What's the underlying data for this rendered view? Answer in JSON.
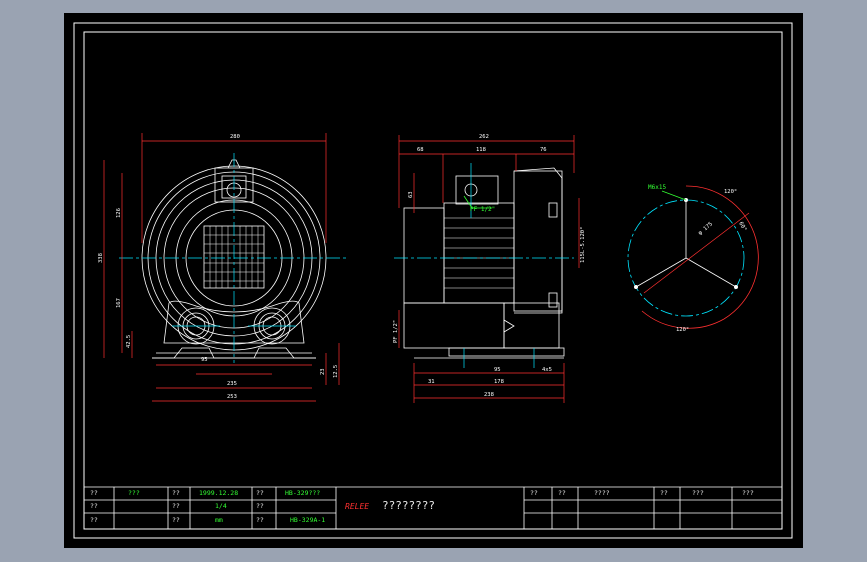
{
  "drawing": {
    "front_dims": {
      "top_width": "280",
      "width_mid": "235",
      "width_bottom": "253",
      "inner_base": "95",
      "height_total": "338",
      "height_upper": "126",
      "height_lower": "167",
      "base_small": "23",
      "base_small2": "12.5",
      "left_small": "42.5"
    },
    "side_dims": {
      "top_total": "262",
      "top_a": "68",
      "top_b": "118",
      "top_c": "76",
      "bottom_a": "31",
      "bottom_b": "95",
      "bottom_c": "178",
      "bottom_d": "4x5",
      "bottom_total": "238",
      "left_upper": "63",
      "pf_label": "PF 1/2\"",
      "right_label": "115L-5.120°",
      "pf_lower": "PF 1/2\""
    },
    "flange": {
      "bolt_label": "M6x15",
      "angle_120": "120°",
      "angle_60": "60°",
      "diameter": "φ 175",
      "angle_bottom": "120°"
    }
  },
  "title_block": {
    "row1": [
      "??",
      "???",
      "??",
      "1999.12.28",
      "??",
      "HB-329???"
    ],
    "row2": [
      "??",
      "",
      "??",
      "1/4",
      "??",
      ""
    ],
    "row3": [
      "??",
      "",
      "??",
      "mm",
      "??",
      "HB-329A-1"
    ],
    "brand": "RELEE",
    "title": "????????",
    "right_row1": [
      "??",
      "??",
      "????",
      "??",
      "???",
      "???"
    ]
  }
}
